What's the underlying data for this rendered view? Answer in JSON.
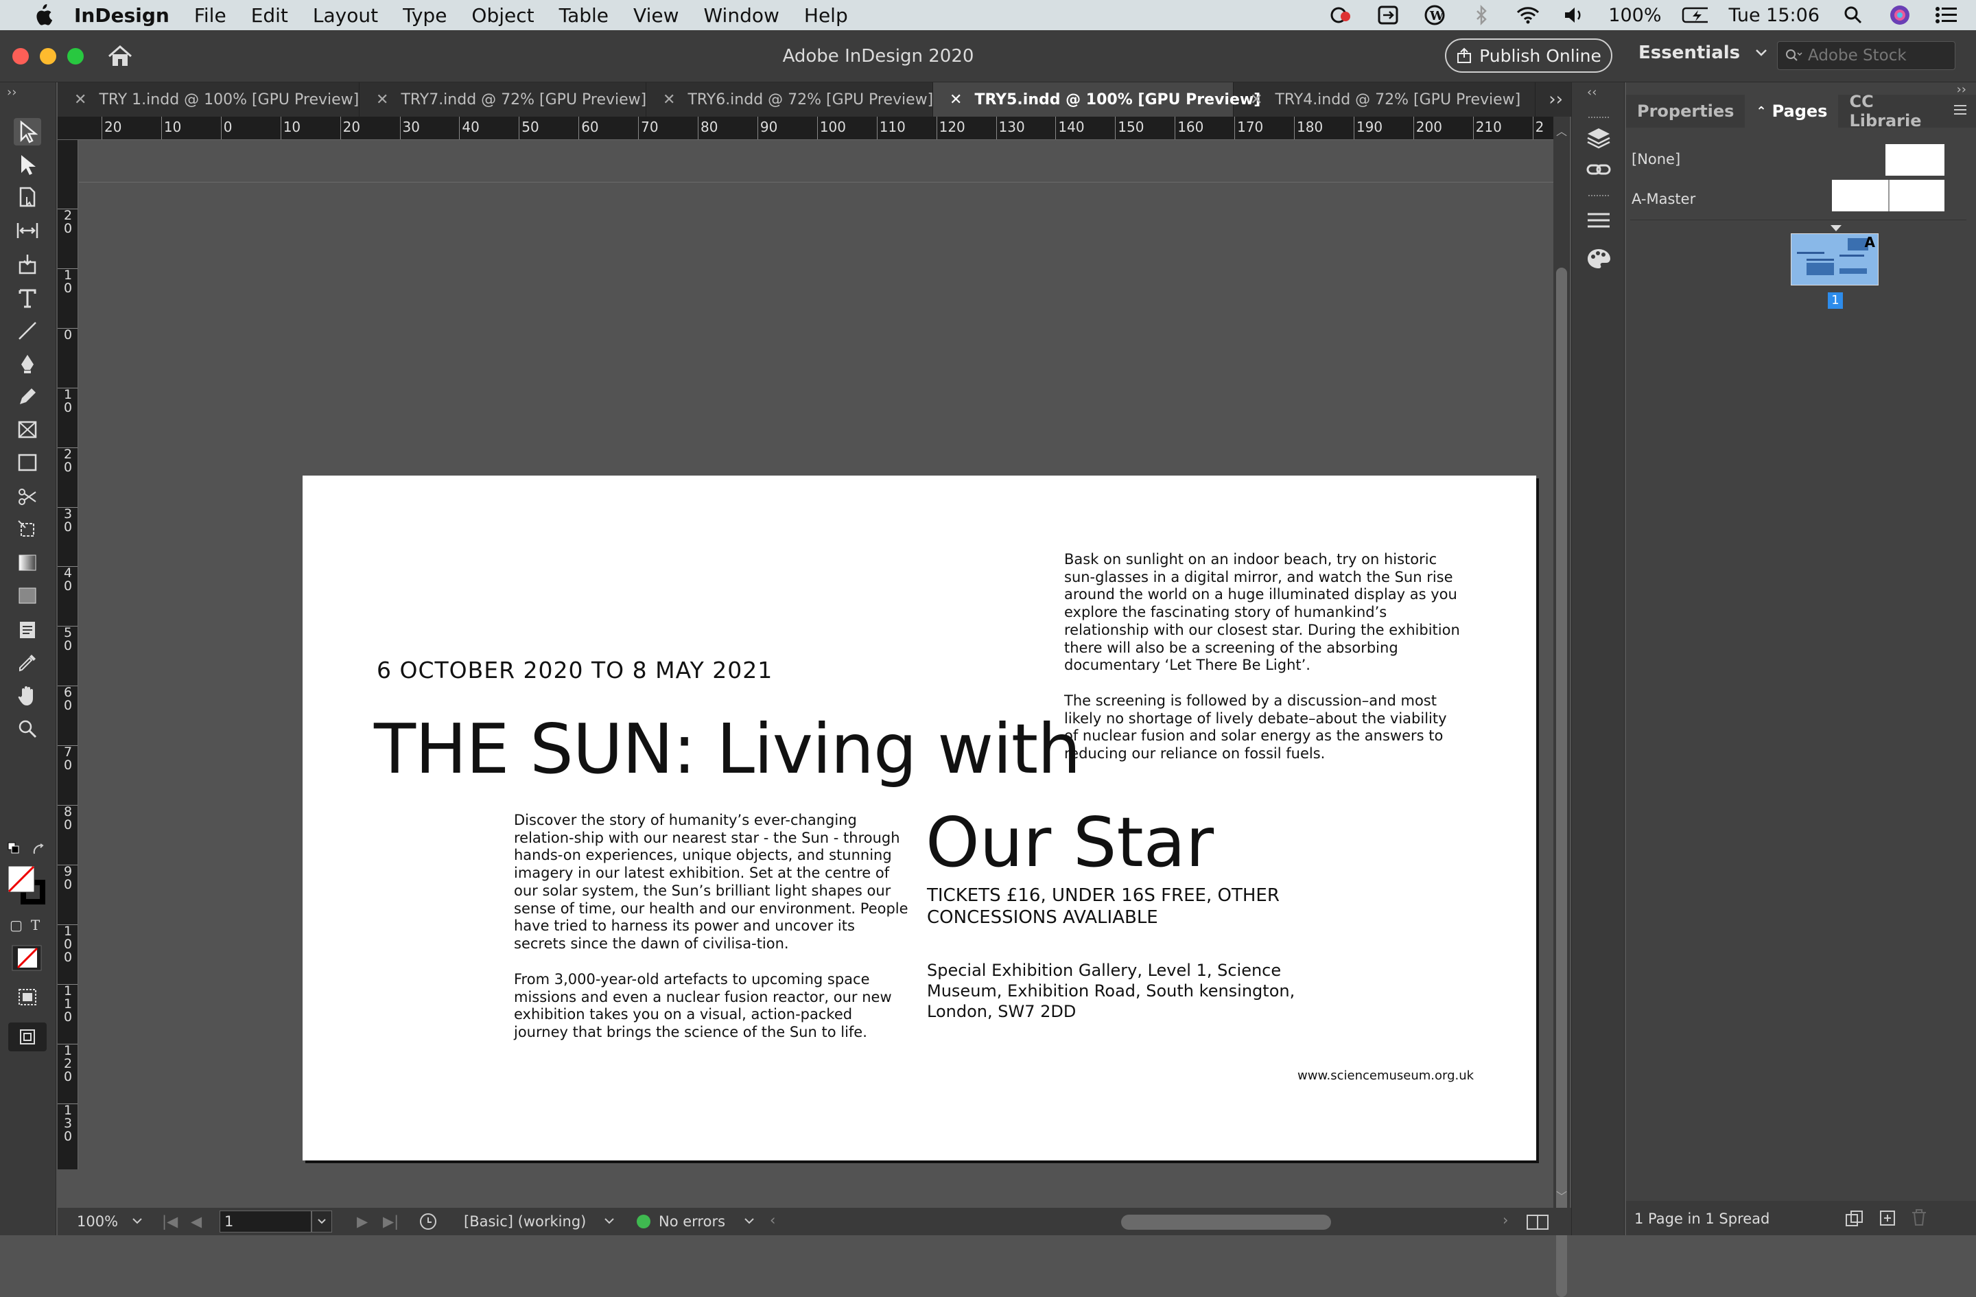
{
  "menubar": {
    "app_name": "InDesign",
    "items": [
      "File",
      "Edit",
      "Layout",
      "Type",
      "Object",
      "Table",
      "View",
      "Window",
      "Help"
    ],
    "battery": "100%",
    "clock": "Tue 15:06"
  },
  "appbar": {
    "title": "Adobe InDesign 2020",
    "publish_label": "Publish Online",
    "workspace_label": "Essentials",
    "stock_placeholder": "Adobe Stock"
  },
  "tabs": [
    {
      "label": "TRY 1.indd @ 100% [GPU Preview]",
      "active": false
    },
    {
      "label": "TRY7.indd @ 72% [GPU Preview]",
      "active": false
    },
    {
      "label": "TRY6.indd @ 72% [GPU Preview]",
      "active": false
    },
    {
      "label": "TRY5.indd @ 100% [GPU Preview]",
      "active": true
    },
    {
      "label": "TRY4.indd @ 72% [GPU Preview]",
      "active": false
    }
  ],
  "ruler": {
    "h_labels": [
      "20",
      "10",
      "0",
      "10",
      "20",
      "30",
      "40",
      "50",
      "60",
      "70",
      "80",
      "90",
      "100",
      "110",
      "120",
      "130",
      "140",
      "150",
      "160",
      "170",
      "180",
      "190",
      "200",
      "210",
      "2"
    ],
    "v_labels": [
      "2 0",
      "1 0",
      "0",
      "1 0",
      "2 0",
      "3 0",
      "4 0",
      "5 0",
      "6 0",
      "7 0",
      "8 0",
      "9 0",
      "1 0 0",
      "1 1 0",
      "1 2 0",
      "1 3 0"
    ]
  },
  "document": {
    "date_line": "6 OCTOBER 2020 TO 8 MAY 2021",
    "headline_1": "THE SUN: Living with",
    "headline_2": "Our Star",
    "intro_1": "Discover the story of humanity’s ever-changing relation-ship with our nearest star - the Sun - through hands-on experiences, unique objects, and stunning imagery in our latest exhibition. Set at the centre of our solar system, the Sun’s brilliant light shapes our sense of time, our health and our environment. People have tried to harness its power and uncover its secrets since the dawn of civilisa-tion.",
    "intro_2": "From 3,000-year-old artefacts to upcoming space missions and even a nuclear fusion reactor, our new exhibition takes you on a visual, action-packed journey that brings the science of the Sun to life.",
    "side_1": "Bask on sunlight on an indoor beach, try on historic sun-glasses in a digital mirror, and watch the Sun rise around the world on a huge illuminated display as you explore the fascinating story of humankind’s relationship with our closest star. During the exhibition there will also be a screening of the absorbing documentary ‘Let There Be Light’.",
    "side_2": "The screening is followed by a discussion–and most likely no shortage of lively debate–about the viability of nuclear fusion and solar energy as the answers to reducing our reliance on fossil fuels.",
    "tickets": "TICKETS £16, UNDER 16S FREE, OTHER CONCESSIONS AVALIABLE",
    "address": "Special Exhibition Gallery, Level 1, Science Museum, Exhibition Road, South kensington, London, SW7 2DD",
    "url": "www.sciencemuseum.org.uk"
  },
  "pages_panel": {
    "tabs": [
      "Properties",
      "Pages",
      "CC Librarie"
    ],
    "none_label": "[None]",
    "master_label": "A-Master",
    "thumb_master": "A",
    "page_number": "1",
    "footer": "1 Page in 1 Spread"
  },
  "status": {
    "zoom": "100%",
    "page_field": "1",
    "profile": "[Basic] (working)",
    "preflight": "No errors"
  },
  "colors": {
    "accent": "#2d8ceb",
    "ok_green": "#3fb950",
    "thumb_blue": "#89b8e8"
  }
}
